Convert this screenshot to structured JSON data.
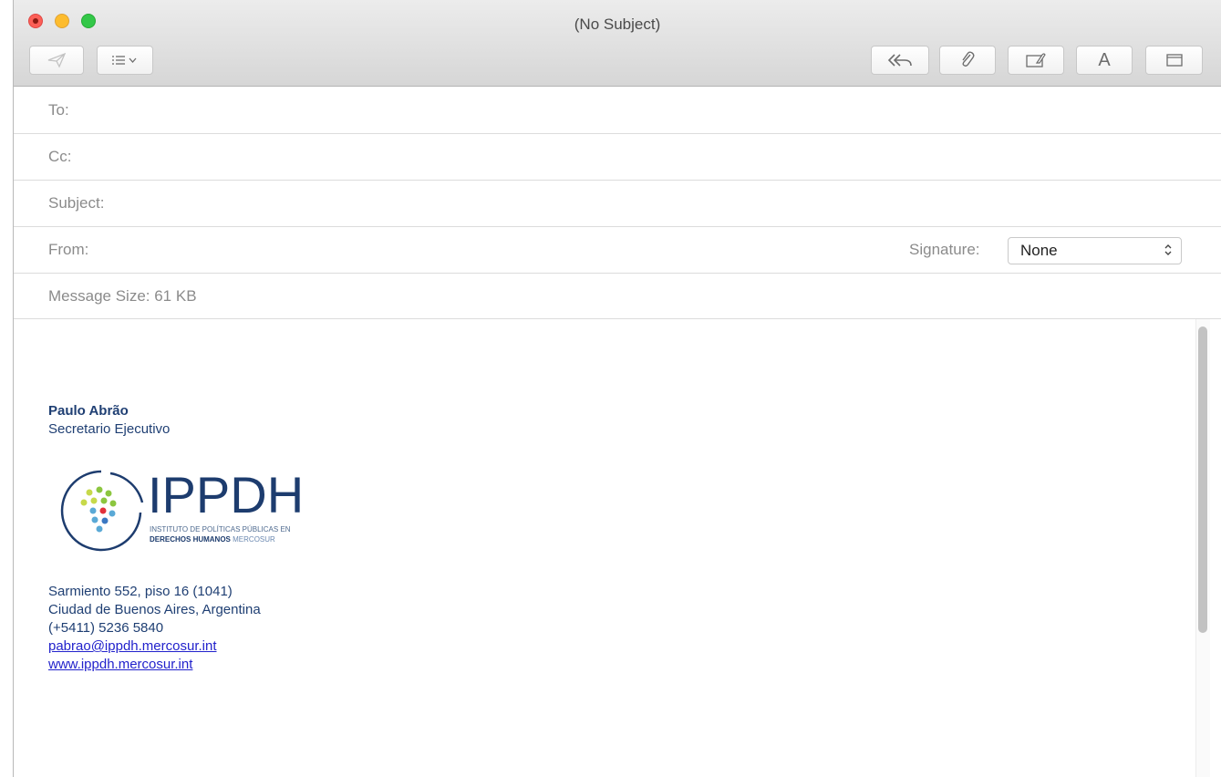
{
  "window": {
    "title": "(No Subject)"
  },
  "toolbar": {
    "send_icon": "paper-plane-icon",
    "header_options_icon": "list-chevron-icon",
    "reply_all_icon": "reply-all-icon",
    "attach_icon": "paperclip-icon",
    "markup_icon": "markup-icon",
    "format_label": "A",
    "photo_browser_icon": "window-icon"
  },
  "fields": {
    "to_label": "To:",
    "cc_label": "Cc:",
    "subject_label": "Subject:",
    "from_label": "From:",
    "signature_label": "Signature:",
    "signature_value": "None",
    "message_size": "Message Size: 61 KB"
  },
  "signature": {
    "name": "Paulo Abrão",
    "role": "Secretario Ejecutivo",
    "logo": {
      "wordmark": "IPPDH",
      "line1": "INSTITUTO DE POLÍTICAS PÚBLICAS EN",
      "line2_bold": "DERECHOS HUMANOS",
      "line2_light": "MERCOSUR"
    },
    "address_line1": "Sarmiento 552, piso 16 (1041)",
    "address_line2": "Ciudad de Buenos Aires, Argentina",
    "phone": "(+5411) 5236 5840",
    "email": "pabrao@ippdh.mercosur.int",
    "website": "www.ippdh.mercosur.int"
  },
  "colors": {
    "signature_text": "#1f3f73",
    "link": "#2222cc",
    "logo_navy": "#1d3c6e"
  }
}
